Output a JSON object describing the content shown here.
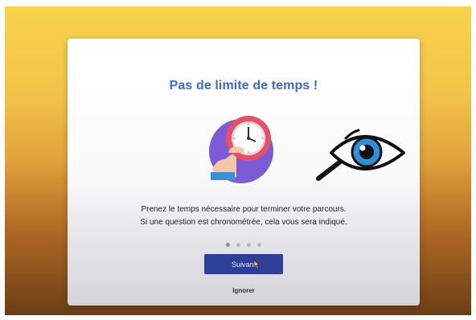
{
  "dialog": {
    "title": "Pas de limite de temps !",
    "body_line_1": "Prenez le temps nécessaire pour terminer votre parcours.",
    "body_line_2": "Si une question est chronométrée, cela vous sera indiqué.",
    "pagination": {
      "total": 4,
      "current": 1
    },
    "next_label": "Suivant",
    "skip_label": "Ignorer"
  },
  "illustrations": {
    "clock": "clock-icon",
    "eye": "eye-magnifier-icon"
  },
  "colors": {
    "title": "#3f68d6",
    "primary_button": "#2d3f97",
    "clock_ring": "#e8506a",
    "eye_iris": "#2f8fd8",
    "backdrop_top": "#f7d34c",
    "backdrop_bottom": "#6d3e16"
  }
}
